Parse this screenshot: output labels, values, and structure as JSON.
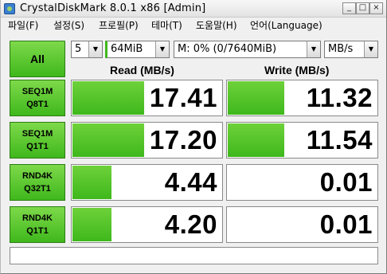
{
  "window": {
    "title": "CrystalDiskMark 8.0.1 x86 [Admin]",
    "min_glyph": "_",
    "max_glyph": "□",
    "close_glyph": "×"
  },
  "menu": {
    "items": [
      {
        "label": "파일(F)"
      },
      {
        "label": "설정(S)"
      },
      {
        "label": "프로필(P)"
      },
      {
        "label": "테마(T)"
      },
      {
        "label": "도움말(H)"
      },
      {
        "label": "언어(Language)"
      }
    ]
  },
  "controls": {
    "all_label": "All",
    "count": "5",
    "size": "64MiB",
    "drive": "M: 0% (0/7640MiB)",
    "unit": "MB/s",
    "arrow_glyph": "▼"
  },
  "headers": {
    "read": "Read (MB/s)",
    "write": "Write (MB/s)"
  },
  "tests": [
    {
      "line1": "SEQ1M",
      "line2": "Q8T1",
      "read": "17.41",
      "write": "11.32",
      "read_fill": 0.48,
      "write_fill": 0.38
    },
    {
      "line1": "SEQ1M",
      "line2": "Q1T1",
      "read": "17.20",
      "write": "11.54",
      "read_fill": 0.48,
      "write_fill": 0.38
    },
    {
      "line1": "RND4K",
      "line2": "Q32T1",
      "read": "4.44",
      "write": "0.01",
      "read_fill": 0.26,
      "write_fill": 0.0
    },
    {
      "line1": "RND4K",
      "line2": "Q1T1",
      "read": "4.20",
      "write": "0.01",
      "read_fill": 0.26,
      "write_fill": 0.0
    }
  ],
  "comment": ""
}
